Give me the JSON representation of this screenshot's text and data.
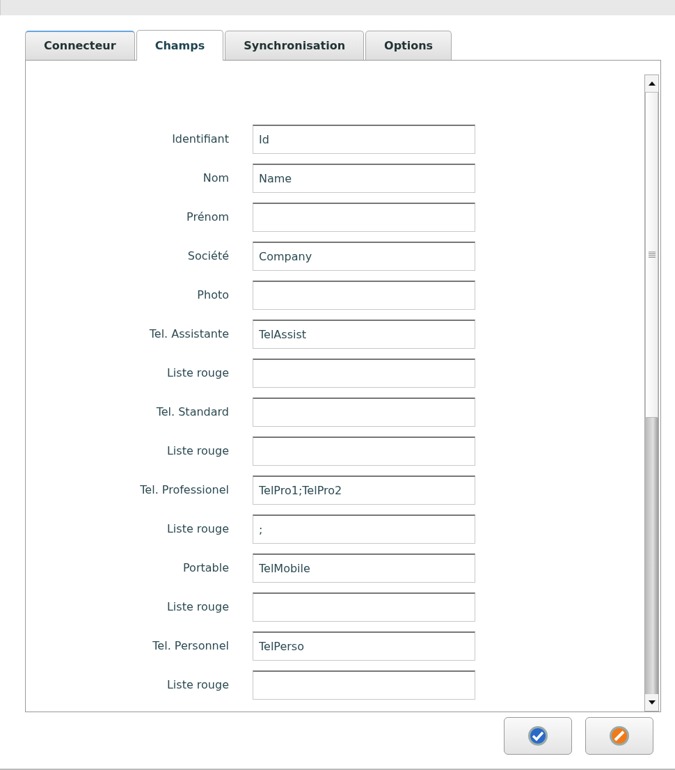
{
  "tabs": [
    {
      "label": "Connecteur",
      "selected": false
    },
    {
      "label": "Champs",
      "selected": true
    },
    {
      "label": "Synchronisation",
      "selected": false
    },
    {
      "label": "Options",
      "selected": false
    }
  ],
  "fields": [
    {
      "label": "Identifiant",
      "value": "Id"
    },
    {
      "label": "Nom",
      "value": "Name"
    },
    {
      "label": "Prénom"
    },
    {
      "label": "Société",
      "value": "Company"
    },
    {
      "label": "Photo"
    },
    {
      "label": "Tel. Assistante",
      "value": "TelAssist"
    },
    {
      "label": "Liste rouge"
    },
    {
      "label": "Tel. Standard"
    },
    {
      "label": "Liste rouge"
    },
    {
      "label": "Tel. Professionel",
      "value": "TelPro1;TelPro2"
    },
    {
      "label": "Liste rouge",
      "value": ";"
    },
    {
      "label": "Portable",
      "value": "TelMobile"
    },
    {
      "label": "Liste rouge"
    },
    {
      "label": "Tel. Personnel",
      "value": "TelPerso"
    },
    {
      "label": "Liste rouge"
    }
  ],
  "buttons": [
    {
      "kind": "confirm"
    },
    {
      "kind": "cancel"
    }
  ]
}
